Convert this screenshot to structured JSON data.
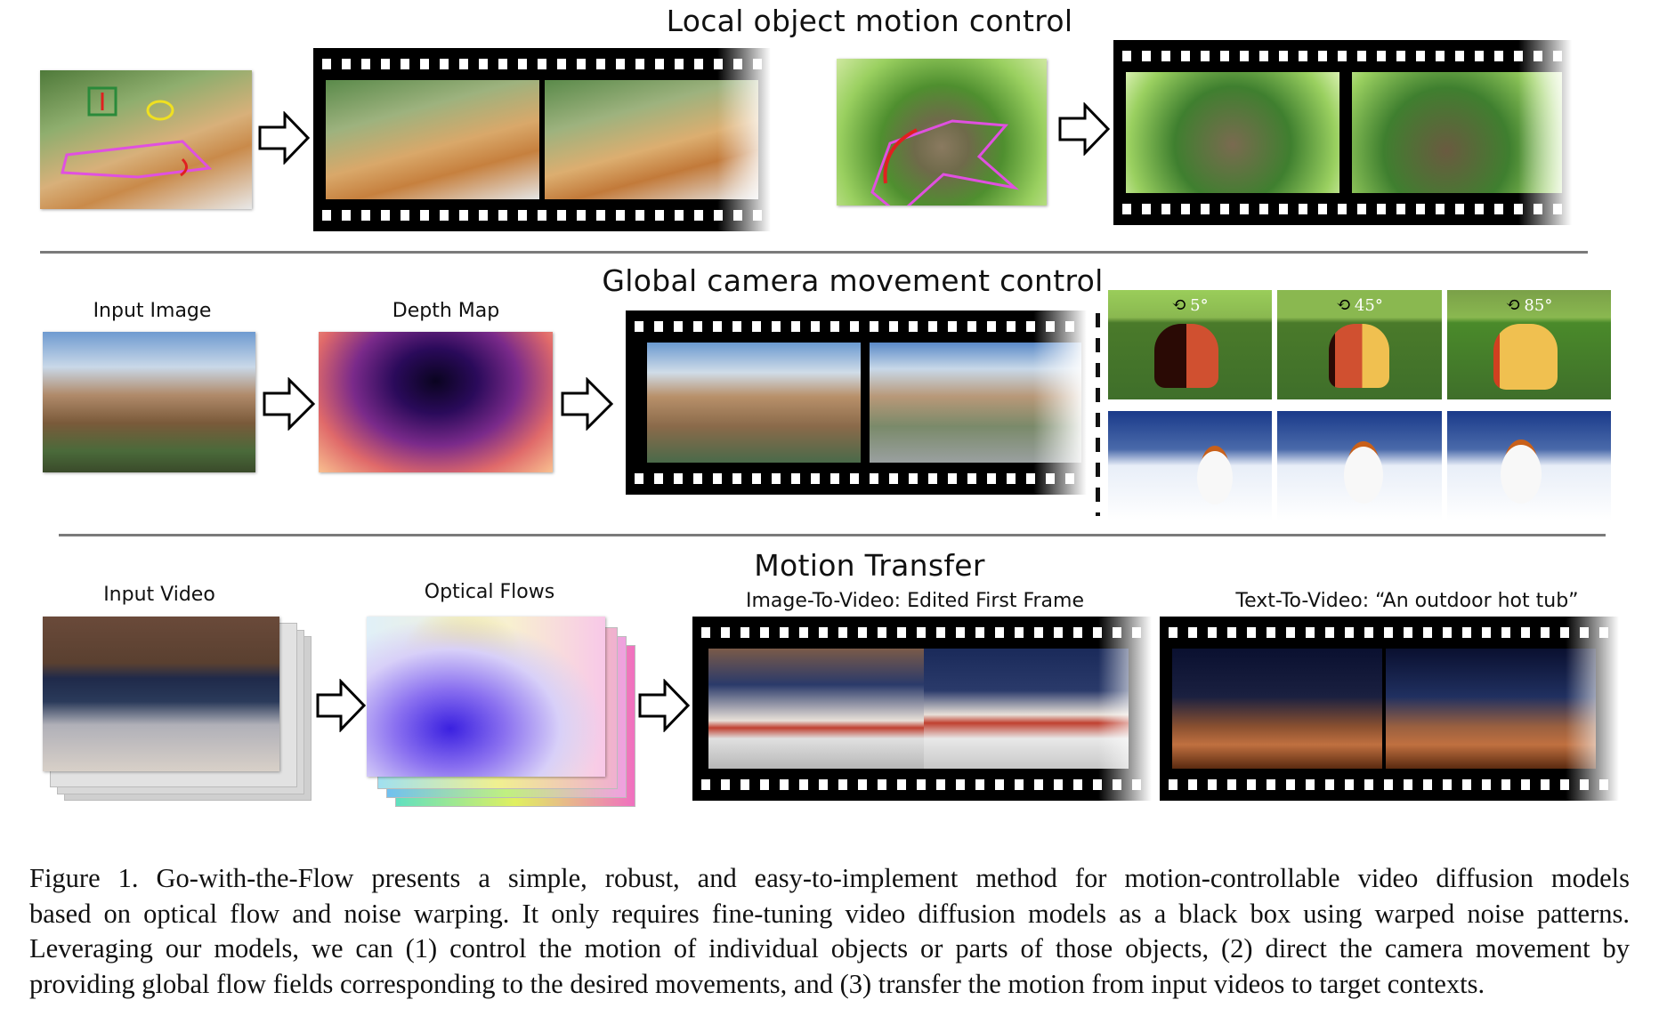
{
  "sections": {
    "local": {
      "title": "Local object motion control"
    },
    "global": {
      "title": "Global camera movement control",
      "input_label": "Input Image",
      "depth_label": "Depth Map",
      "rotations": [
        "5°",
        "45°",
        "85°"
      ],
      "rotation_icon": "rotate-axis-icon"
    },
    "transfer": {
      "title": "Motion Transfer",
      "input_label": "Input Video",
      "flows_label": "Optical Flows",
      "i2v_label": "Image-To-Video: Edited First Frame",
      "t2v_label": "Text-To-Video: “An outdoor hot tub”"
    }
  },
  "caption": {
    "lines": [
      "Figure 1.  Go-with-the-Flow presents a simple, robust, and easy-to-implement method for motion-controllable video diffusion models",
      "based on optical flow and noise warping. It only requires fine-tuning video diffusion models as a black box using warped noise patterns.",
      "Leveraging our models, we can (1) control the motion of individual objects or parts of those objects, (2) direct the camera movement by",
      "providing global flow fields corresponding to the desired movements, and (3) transfer the motion from input videos to target contexts."
    ]
  }
}
